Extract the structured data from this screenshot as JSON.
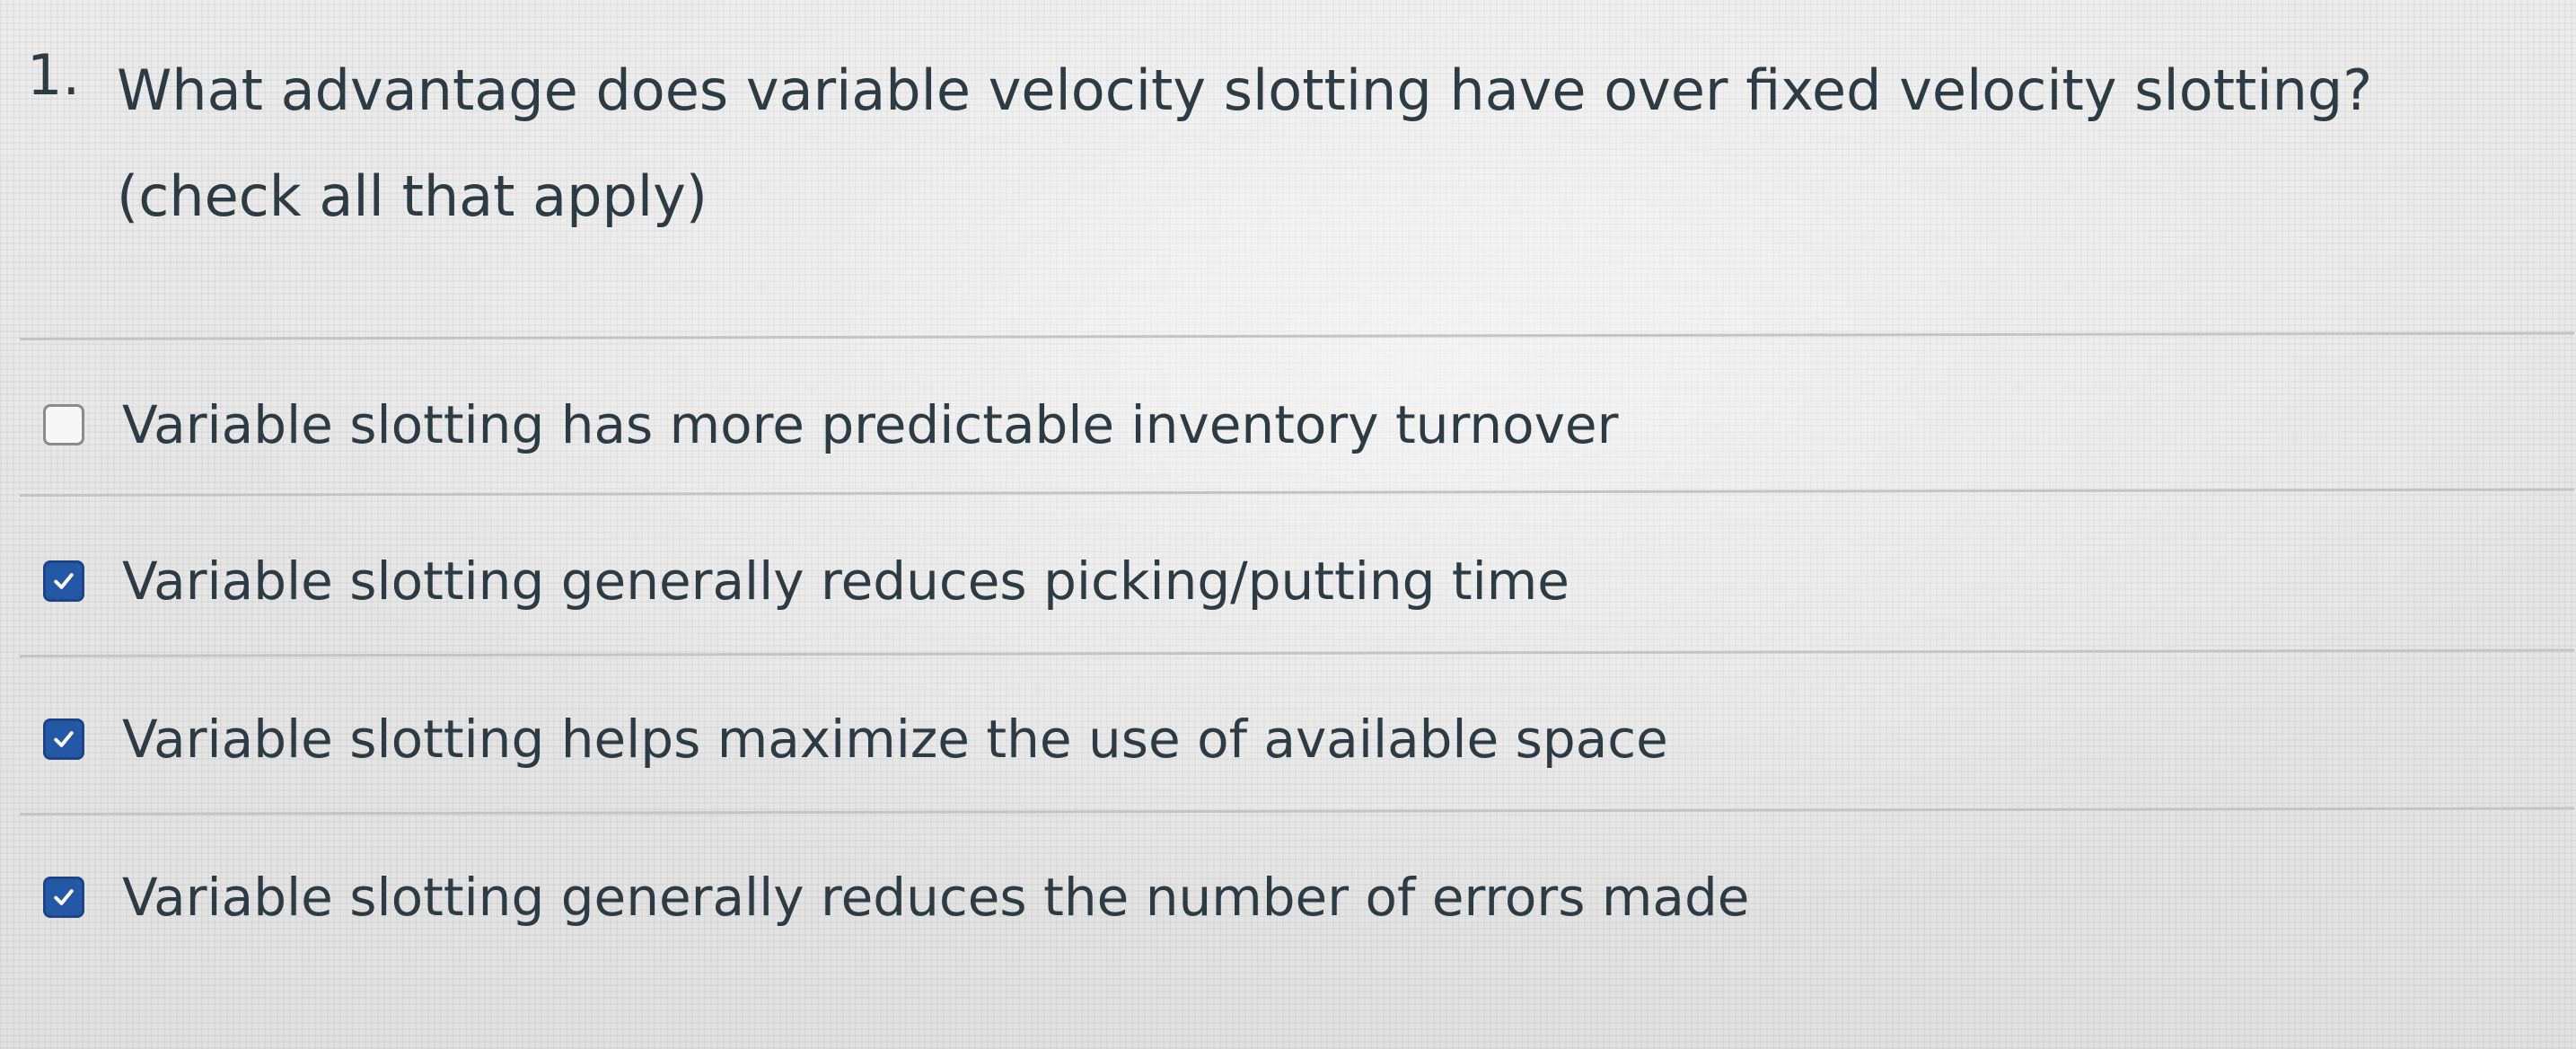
{
  "question": {
    "number": "1.",
    "text": "What advantage does variable velocity slotting have over fixed velocity slotting? (check all that apply)"
  },
  "answers": [
    {
      "label": "Variable slotting has more predictable inventory turnover",
      "checked": false
    },
    {
      "label": "Variable slotting generally reduces picking/putting time",
      "checked": true
    },
    {
      "label": "Variable slotting helps maximize the use of available space",
      "checked": true
    },
    {
      "label": "Variable slotting generally reduces the number of errors made",
      "checked": true
    }
  ],
  "icons": {
    "checkbox_unchecked": "checkbox-empty-icon",
    "checkbox_checked": "checkmark-icon"
  },
  "colors": {
    "text": "#2d3b45",
    "checkbox_checked_fill": "#2557a7",
    "checkbox_unchecked_border": "#8b8b8b",
    "divider": "#c4c4c4"
  }
}
